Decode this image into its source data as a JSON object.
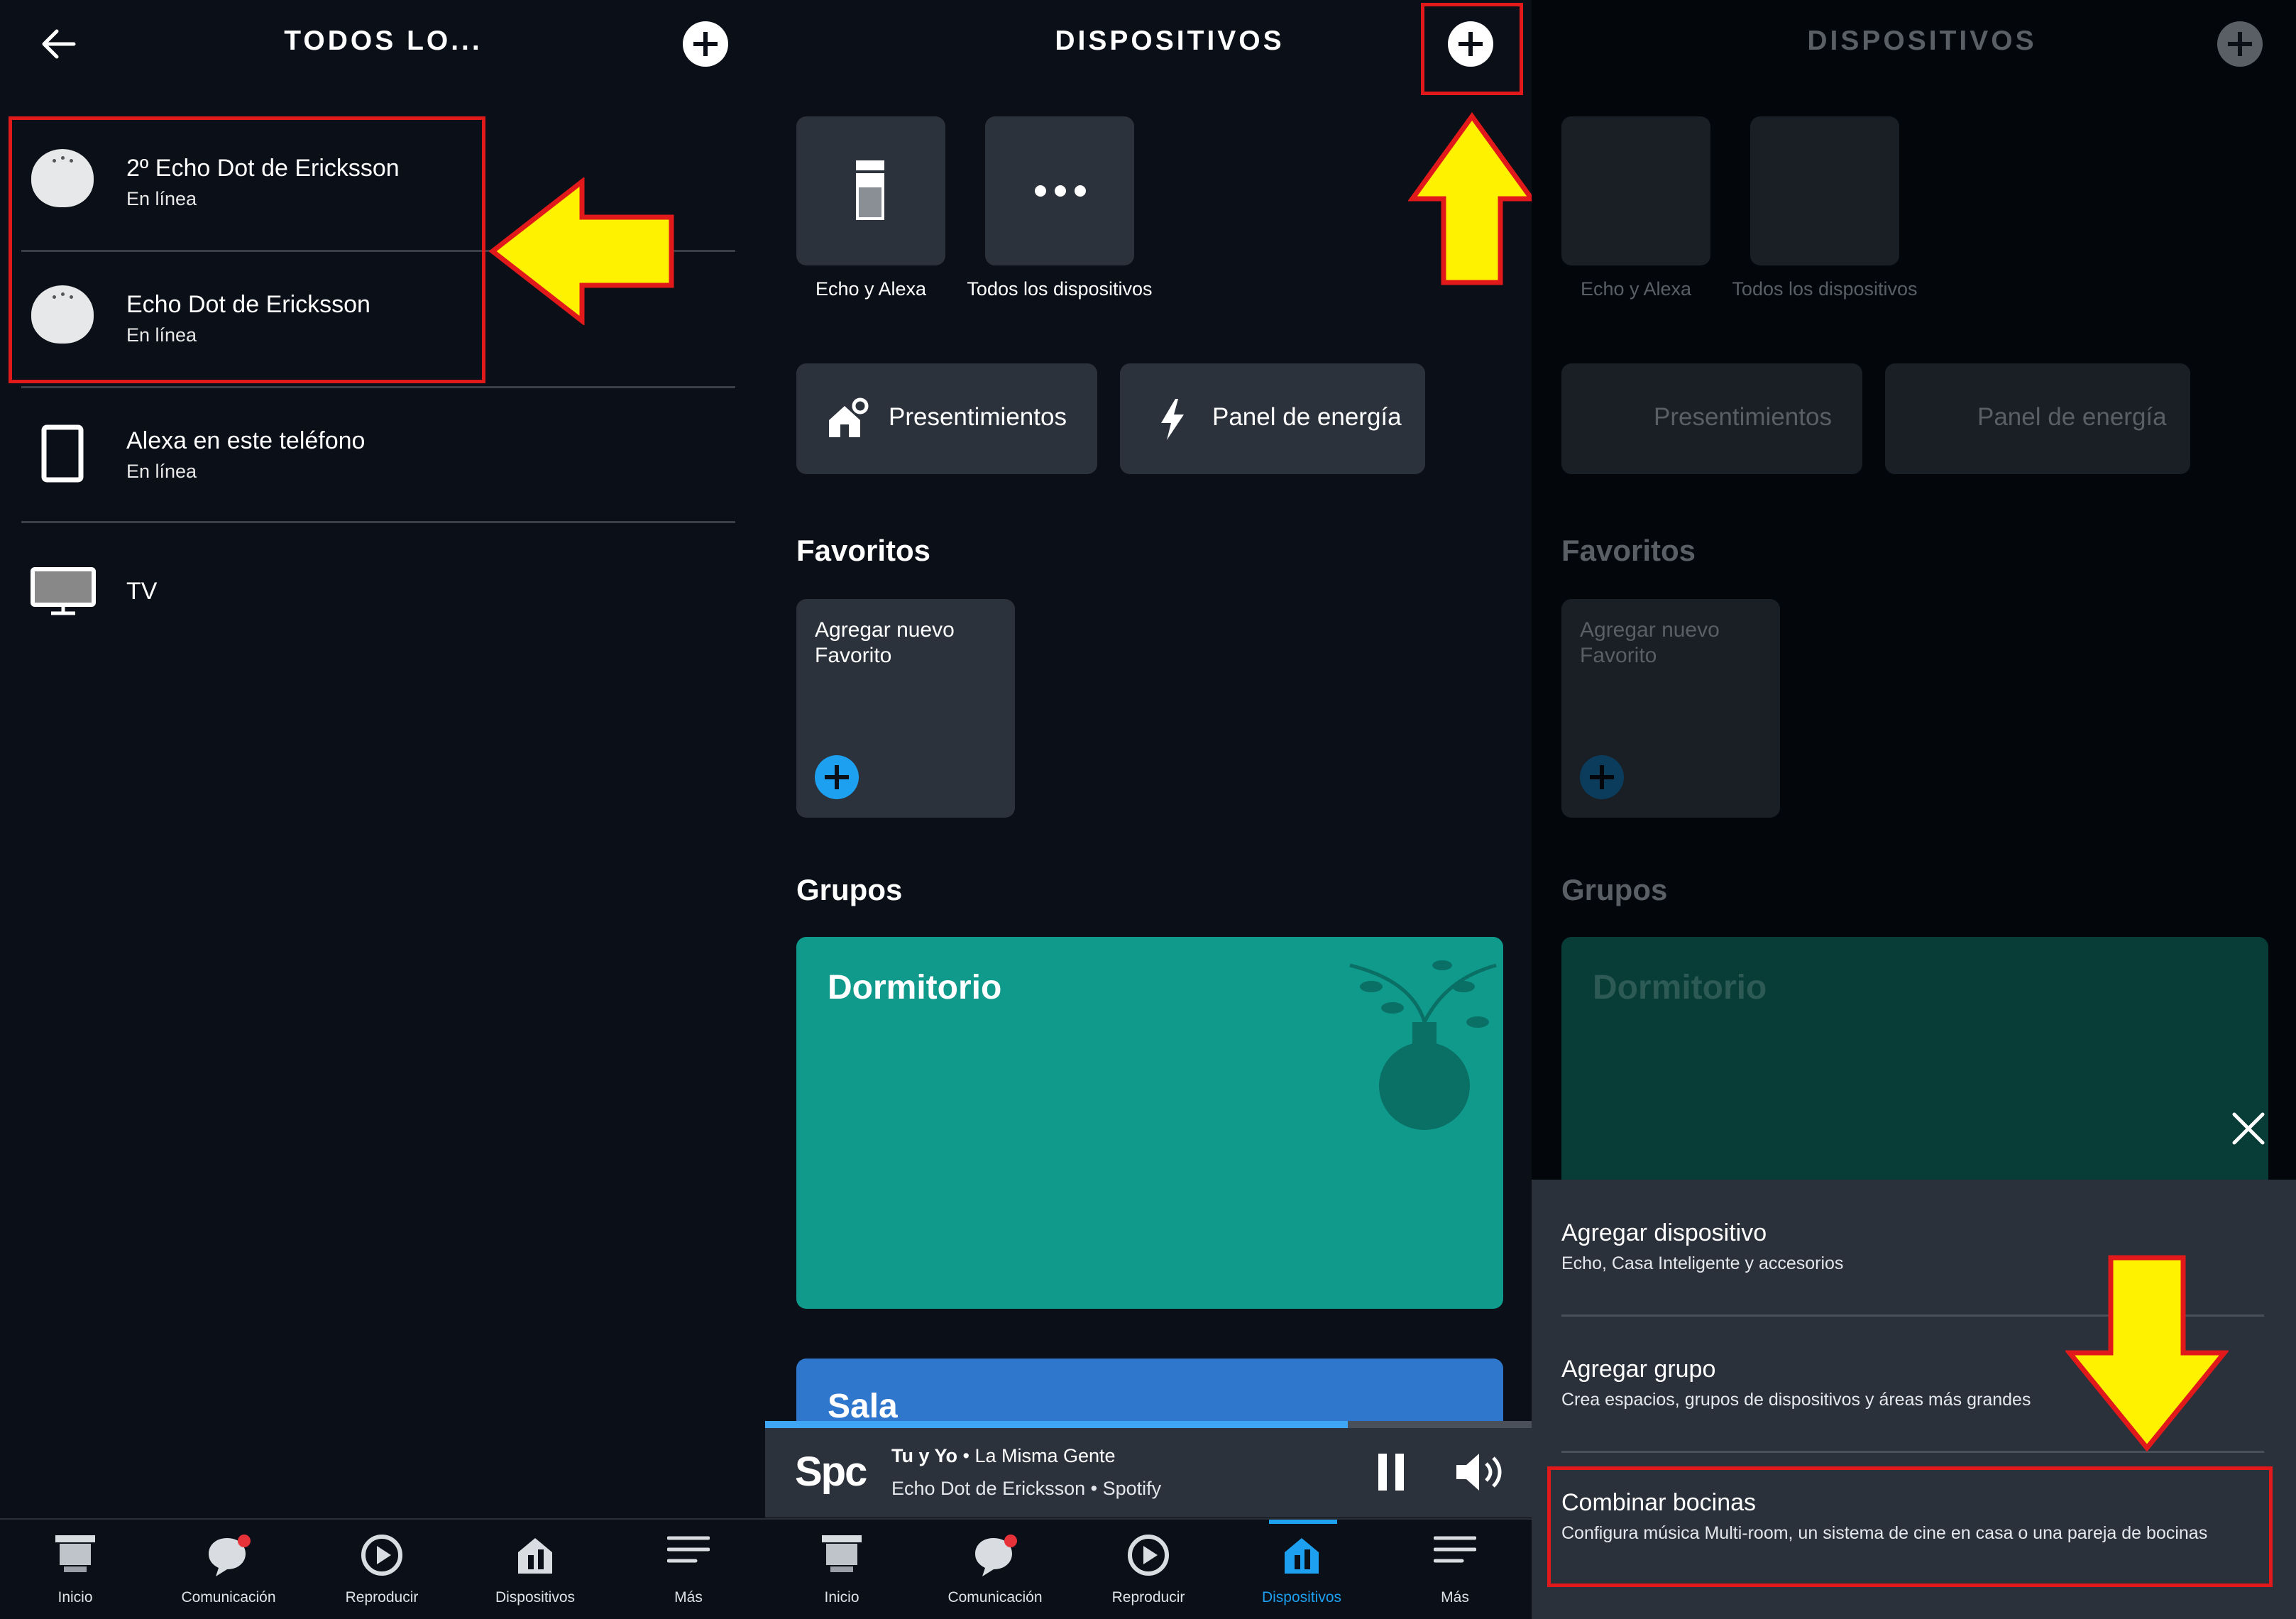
{
  "panel1": {
    "title": "TODOS LO...",
    "devices": [
      {
        "name": "2º Echo Dot de Ericksson",
        "status": "En línea"
      },
      {
        "name": "Echo Dot de Ericksson",
        "status": "En línea"
      },
      {
        "name": "Alexa en este teléfono",
        "status": "En línea"
      },
      {
        "name": "TV",
        "status": ""
      }
    ]
  },
  "panel2": {
    "title": "DISPOSITIVOS",
    "tiles": [
      "Echo y Alexa",
      "Todos los dispositivos"
    ],
    "pills": [
      "Presentimientos",
      "Panel de energía"
    ],
    "favorites_heading": "Favoritos",
    "favorite_add": "Agregar nuevo Favorito",
    "groups_heading": "Grupos",
    "groups": [
      "Dormitorio",
      "Sala"
    ],
    "player": {
      "logo": "Spc",
      "track": "Tu y Yo",
      "artist": "• La Misma Gente",
      "source": "Echo Dot de Ericksson • Spotify",
      "progress": 0.76
    }
  },
  "panel3": {
    "title": "DISPOSITIVOS",
    "menu": [
      {
        "title": "Agregar dispositivo",
        "subtitle": "Echo, Casa Inteligente y accesorios"
      },
      {
        "title": "Agregar grupo",
        "subtitle": "Crea espacios, grupos de dispositivos y áreas más grandes"
      },
      {
        "title": "Combinar bocinas",
        "subtitle": "Configura música Multi-room, un sistema de cine en casa o una pareja de bocinas"
      }
    ]
  },
  "nav": {
    "items": [
      "Inicio",
      "Comunicación",
      "Reproducir",
      "Dispositivos",
      "Más"
    ],
    "active_index_panel2": 3
  },
  "colors": {
    "background": "#0b0f17",
    "tile": "#2c323c",
    "teal_group": "#0f9a8c",
    "blue_group": "#2f77cc",
    "accent_blue": "#1ea0f0",
    "highlight_red": "#e2191b",
    "arrow_yellow": "#fff200"
  }
}
